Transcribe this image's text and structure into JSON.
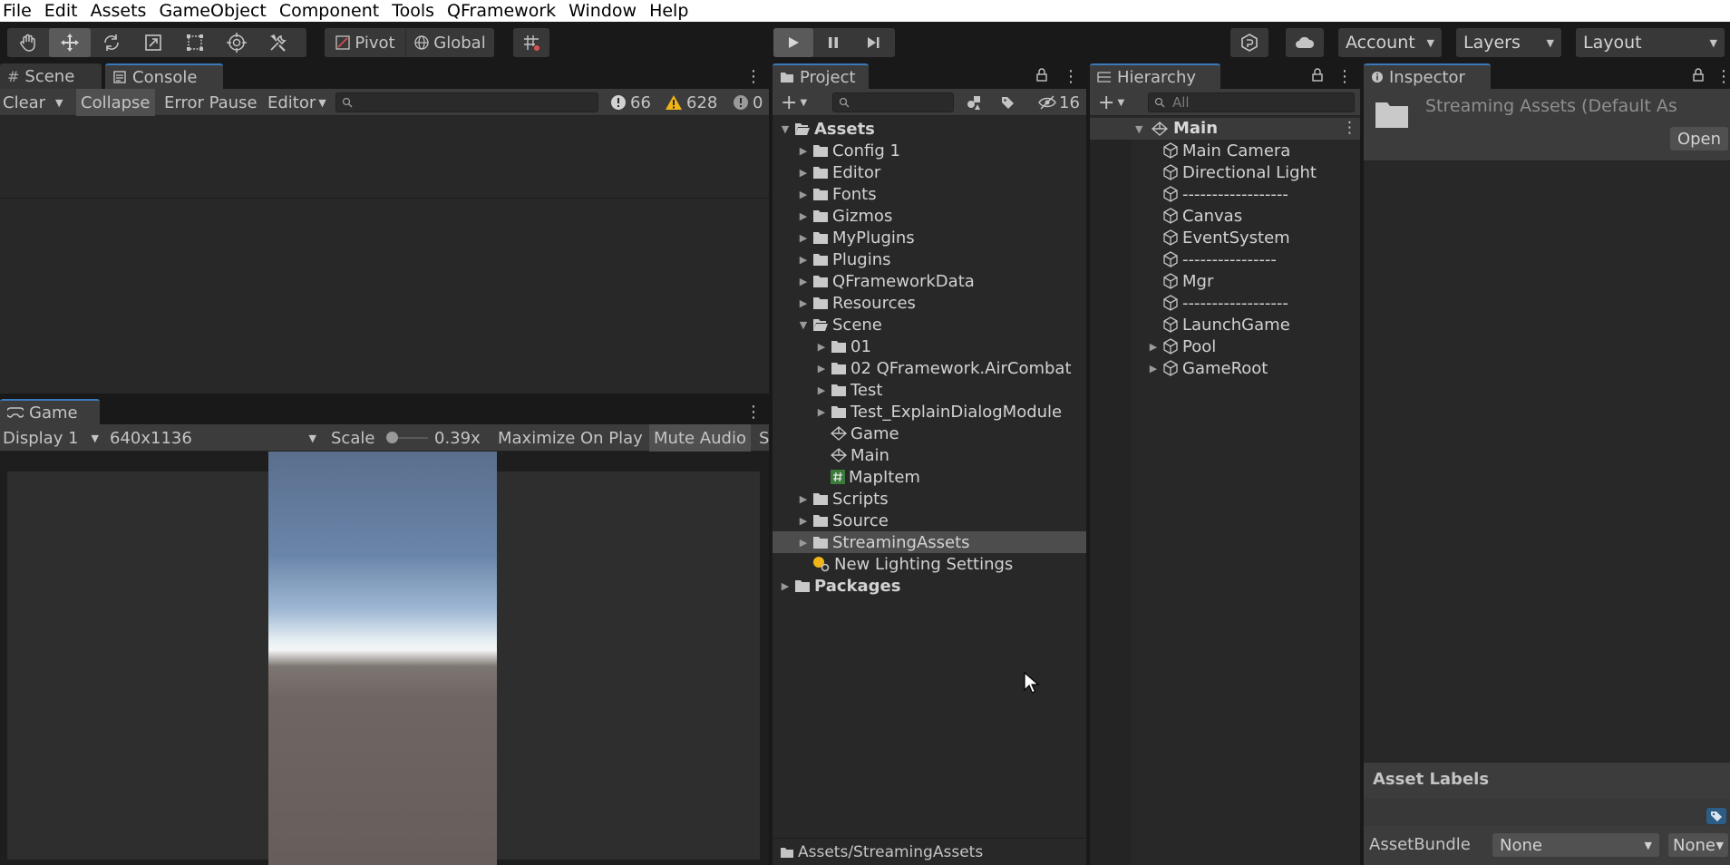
{
  "menu": [
    "File",
    "Edit",
    "Assets",
    "GameObject",
    "Component",
    "Tools",
    "QFramework",
    "Window",
    "Help"
  ],
  "toolbar": {
    "tools": [
      "hand-icon",
      "move-icon",
      "rotate-icon",
      "scale-icon",
      "rect-icon",
      "transform-icon",
      "custom-tool-icon"
    ],
    "pivot": "Pivot",
    "global": "Global",
    "account": "Account",
    "layers": "Layers",
    "layout": "Layout"
  },
  "console": {
    "tabs": {
      "scene": "Scene",
      "console": "Console"
    },
    "clear": "Clear",
    "collapse": "Collapse",
    "error_pause": "Error Pause",
    "editor": "Editor",
    "log_count": "66",
    "warn_count": "628",
    "error_count": "0"
  },
  "game": {
    "tab": "Game",
    "display": "Display 1",
    "resolution": "640x1136",
    "scale_label": "Scale",
    "scale_value": "0.39x",
    "maximize": "Maximize On Play",
    "mute": "Mute Audio",
    "stats": "S"
  },
  "project": {
    "tab": "Project",
    "hidden_count": "16",
    "path": "Assets/StreamingAssets",
    "tree": [
      {
        "label": "Assets",
        "type": "folder-open",
        "indent": 0,
        "arrow": "down",
        "bold": true
      },
      {
        "label": "Config 1",
        "type": "folder",
        "indent": 1,
        "arrow": "right"
      },
      {
        "label": "Editor",
        "type": "folder",
        "indent": 1,
        "arrow": "right"
      },
      {
        "label": "Fonts",
        "type": "folder",
        "indent": 1,
        "arrow": "right"
      },
      {
        "label": "Gizmos",
        "type": "folder",
        "indent": 1,
        "arrow": "right"
      },
      {
        "label": "MyPlugins",
        "type": "folder",
        "indent": 1,
        "arrow": "right"
      },
      {
        "label": "Plugins",
        "type": "folder",
        "indent": 1,
        "arrow": "right"
      },
      {
        "label": "QFrameworkData",
        "type": "folder",
        "indent": 1,
        "arrow": "right"
      },
      {
        "label": "Resources",
        "type": "folder",
        "indent": 1,
        "arrow": "right"
      },
      {
        "label": "Scene",
        "type": "folder-open",
        "indent": 1,
        "arrow": "down"
      },
      {
        "label": "01",
        "type": "folder",
        "indent": 2,
        "arrow": "right"
      },
      {
        "label": "02 QFramework.AirCombat",
        "type": "folder",
        "indent": 2,
        "arrow": "right"
      },
      {
        "label": "Test",
        "type": "folder",
        "indent": 2,
        "arrow": "right"
      },
      {
        "label": "Test_ExplainDialogModule",
        "type": "folder",
        "indent": 2,
        "arrow": "right"
      },
      {
        "label": "Game",
        "type": "unity",
        "indent": 2,
        "arrow": ""
      },
      {
        "label": "Main",
        "type": "unity",
        "indent": 2,
        "arrow": ""
      },
      {
        "label": "MapItem",
        "type": "script",
        "indent": 2,
        "arrow": ""
      },
      {
        "label": "Scripts",
        "type": "folder",
        "indent": 1,
        "arrow": "right"
      },
      {
        "label": "Source",
        "type": "folder",
        "indent": 1,
        "arrow": "right"
      },
      {
        "label": "StreamingAssets",
        "type": "folder",
        "indent": 1,
        "arrow": "right",
        "selected": true
      },
      {
        "label": "New Lighting Settings",
        "type": "lighting",
        "indent": 1,
        "arrow": ""
      },
      {
        "label": "Packages",
        "type": "folder",
        "indent": 0,
        "arrow": "right",
        "bold": true
      }
    ]
  },
  "hierarchy": {
    "tab": "Hierarchy",
    "search_placeholder": "All",
    "scene": "Main",
    "items": [
      {
        "label": "Main Camera",
        "arrow": ""
      },
      {
        "label": "Directional Light",
        "arrow": ""
      },
      {
        "label": "------------------",
        "arrow": ""
      },
      {
        "label": "Canvas",
        "arrow": ""
      },
      {
        "label": "EventSystem",
        "arrow": ""
      },
      {
        "label": "----------------",
        "arrow": ""
      },
      {
        "label": "Mgr",
        "arrow": ""
      },
      {
        "label": "------------------",
        "arrow": ""
      },
      {
        "label": "LaunchGame",
        "arrow": ""
      },
      {
        "label": "Pool",
        "arrow": "right"
      },
      {
        "label": "GameRoot",
        "arrow": "right"
      }
    ]
  },
  "inspector": {
    "tab": "Inspector",
    "title": "Streaming Assets (Default As",
    "open": "Open",
    "asset_labels": "Asset Labels",
    "asset_bundle": "AssetBundle",
    "bundle_value": "None",
    "variant_value": "None"
  }
}
